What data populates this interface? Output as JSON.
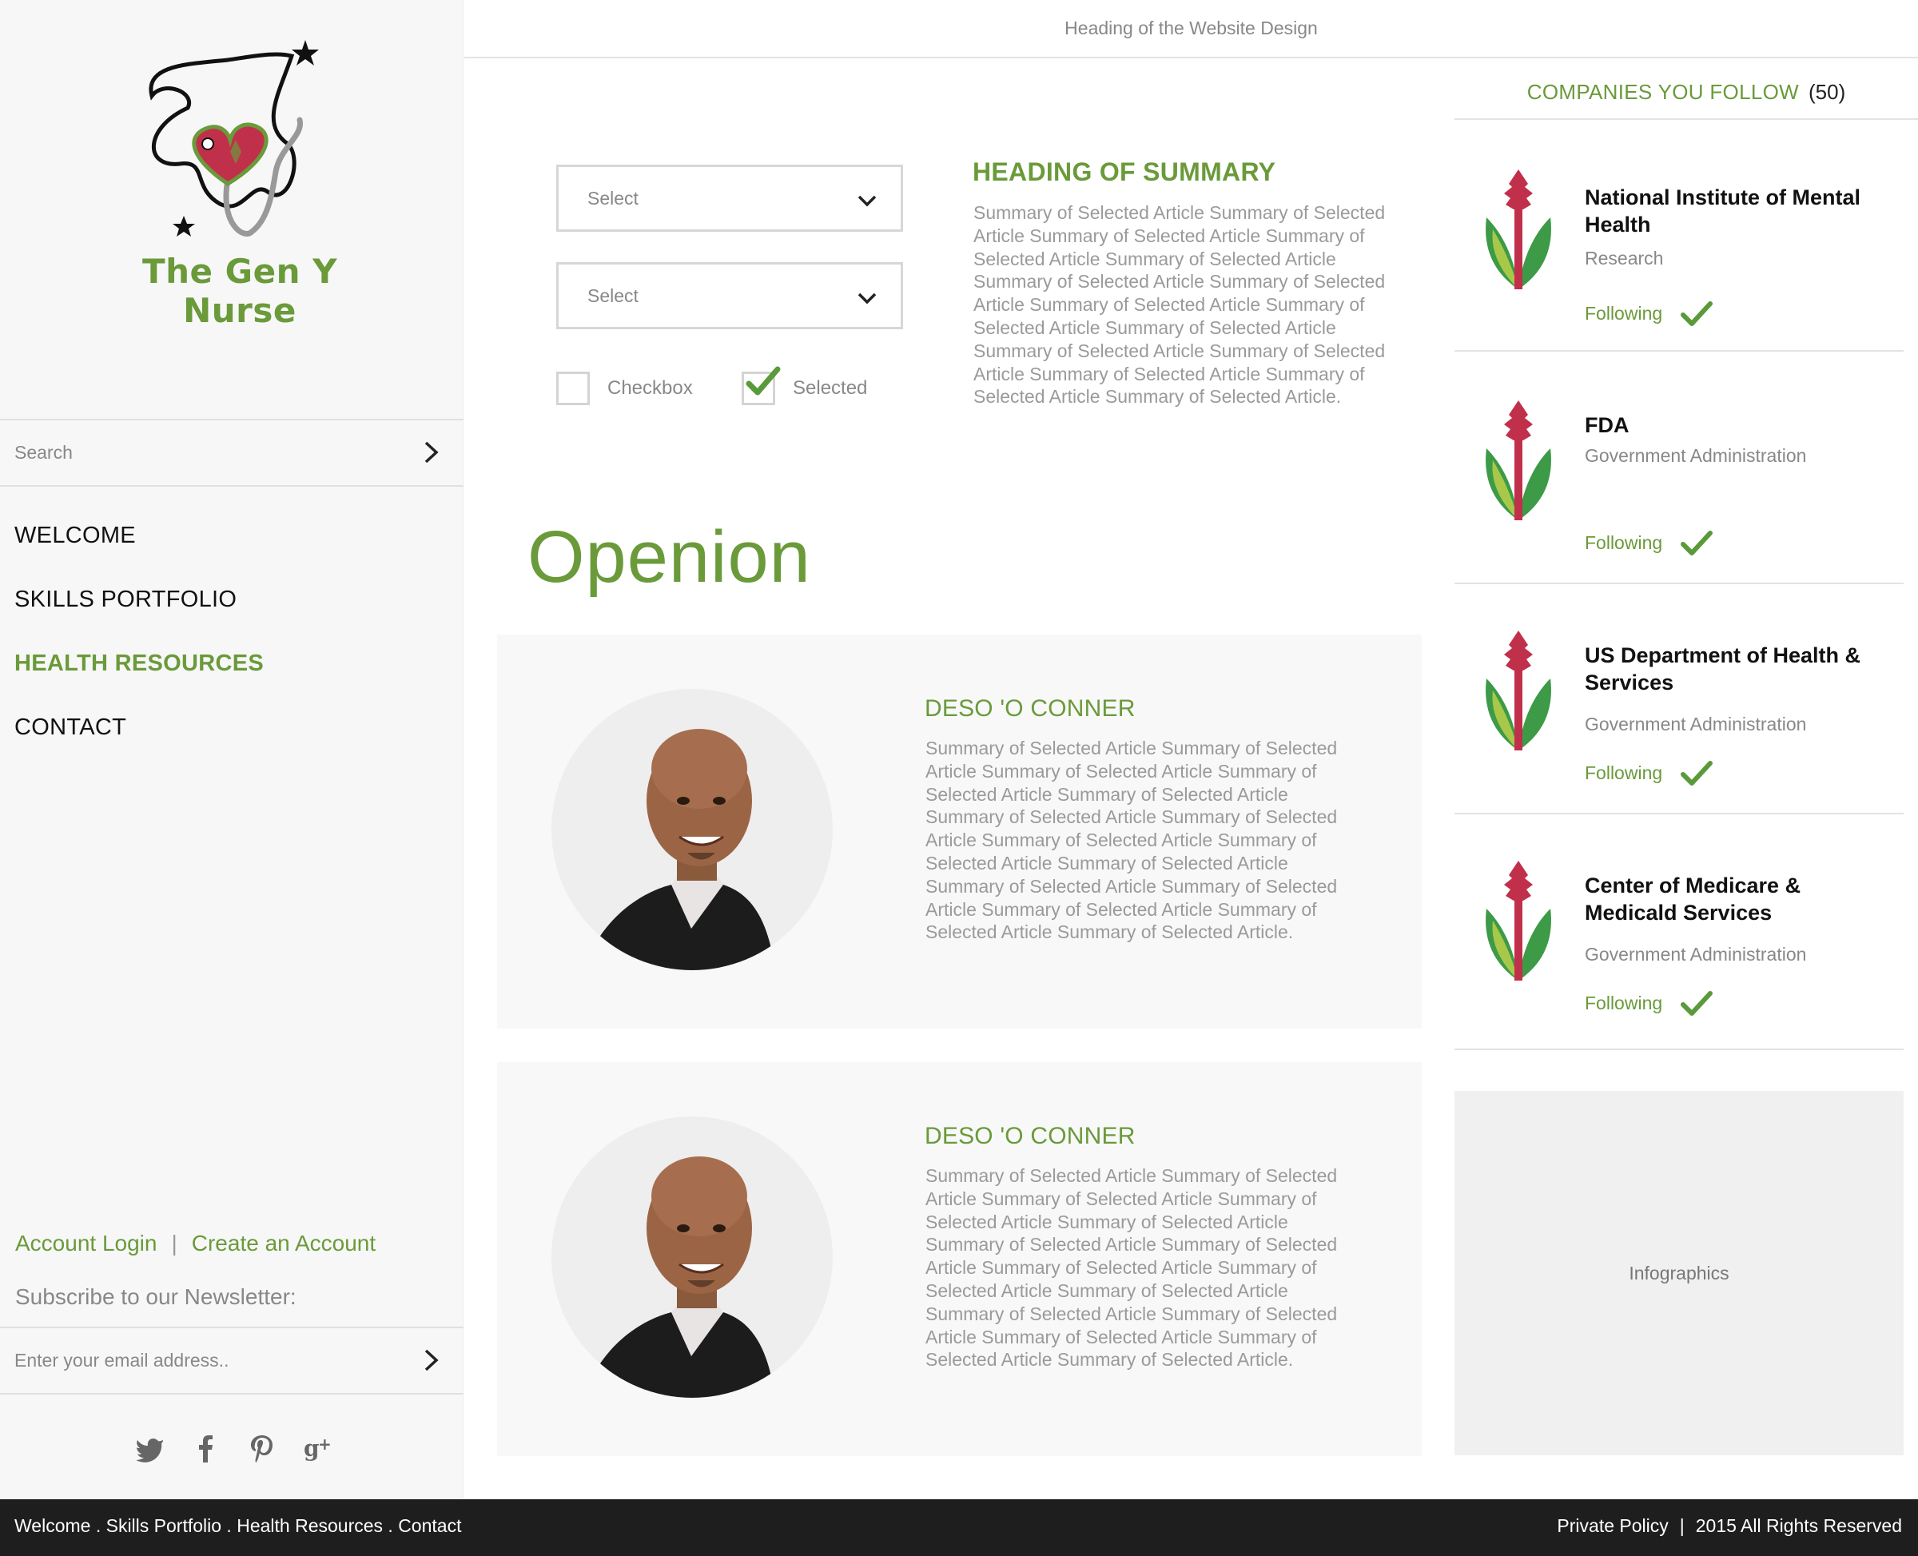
{
  "header": {
    "title": "Heading of the Website Design"
  },
  "sidebar": {
    "brand": "The Gen Y Nurse",
    "search": {
      "placeholder": "Search"
    },
    "nav": [
      {
        "label": "WELCOME",
        "active": false
      },
      {
        "label": "SKILLS PORTFOLIO",
        "active": false
      },
      {
        "label": "HEALTH RESOURCES",
        "active": true
      },
      {
        "label": "CONTACT",
        "active": false
      }
    ],
    "account_login": "Account Login",
    "account_sep": "|",
    "create_account": "Create an Account",
    "newsletter_label": "Subscribe to our Newsletter:",
    "newsletter": {
      "placeholder": "Enter your email address.."
    },
    "social_icons": [
      "twitter-icon",
      "facebook-icon",
      "pinterest-icon",
      "google-plus-icon"
    ]
  },
  "filters": {
    "select1": "Select",
    "select2": "Select",
    "checkbox_label": "Checkbox",
    "checkbox_checked": false,
    "selected_label": "Selected",
    "selected_checked": true
  },
  "summary": {
    "heading": "HEADING OF SUMMARY",
    "text": "Summary of Selected Article Summary of Selected Article  Summary of Selected Article Summary of Selected Article Summary of Selected Article Summary of Selected Article Summary of Selected Article Summary of Selected Article Summary of Selected Article Summary of Selected Article Summary of Selected Article Summary of Selected Article  Summary of Selected Article Summary of Selected Article Summary of Selected Article."
  },
  "opinion": {
    "title": "Openion",
    "items": [
      {
        "name": "DESO 'O CONNER",
        "text": "Summary of Selected Article Summary of Selected Article  Summary of Selected Article Summary of Selected Article Summary of Selected Article Summary of Selected Article Summary of Selected Article Summary of Selected Article Summary of Selected Article Summary of Selected Article Summary of Selected Article Summary of Selected Article  Summary of Selected Article Summary of Selected Article Summary of Selected Article."
      },
      {
        "name": "DESO 'O CONNER",
        "text": "Summary of Selected Article Summary of Selected Article  Summary of Selected Article Summary of Selected Article Summary of Selected Article Summary of Selected Article Summary of Selected Article Summary of Selected Article Summary of Selected Article Summary of Selected Article Summary of Selected Article Summary of Selected Article  Summary of Selected Article Summary of Selected Article Summary of Selected Article."
      }
    ]
  },
  "companies": {
    "heading": "COMPANIES YOU FOLLOW",
    "count": "(50)",
    "items": [
      {
        "name": "National Institute of Mental Health",
        "category": "Research",
        "status": "Following"
      },
      {
        "name": "FDA",
        "category": "Government Administration",
        "status": "Following"
      },
      {
        "name": "US Department of Health & Services",
        "category": "Government Administration",
        "status": "Following"
      },
      {
        "name": "Center of Medicare & Medicald Services",
        "category": "Government Administration",
        "status": "Following"
      }
    ]
  },
  "infographics": {
    "label": "Infographics"
  },
  "footer": {
    "nav_text": "Welcome . Skills Portfolio . Health Resources . Contact",
    "privacy": "Private Policy",
    "sep": "|",
    "rights": "2015 All Rights Reserved"
  },
  "colors": {
    "accent": "#6a9a3a",
    "footer_bg": "#1e1e1e",
    "flower_red": "#c1304a",
    "leaf_green": "#3d9a46"
  }
}
